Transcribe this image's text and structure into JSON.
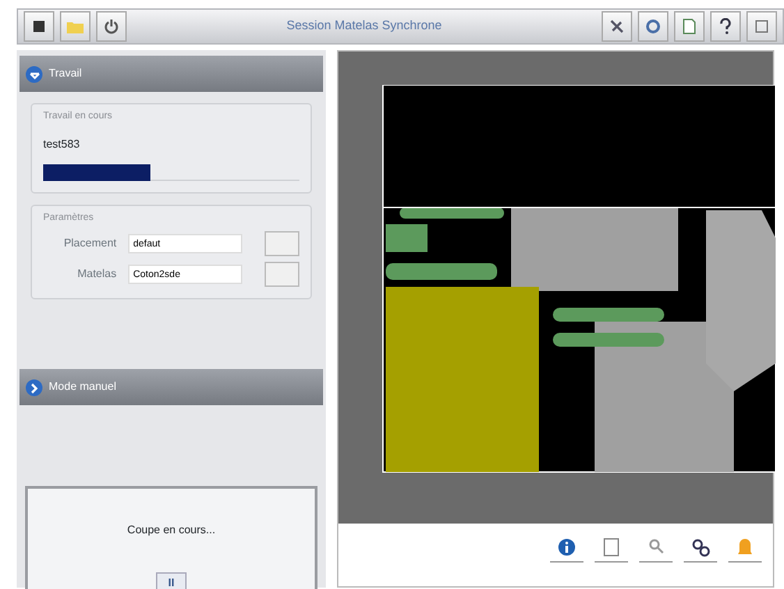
{
  "window": {
    "title": "Session Matelas Synchrone"
  },
  "panels": [
    {
      "title": "Travail",
      "expanded": true
    },
    {
      "title": "Mode manuel",
      "expanded": false
    }
  ],
  "job": {
    "legend": "Travail en cours",
    "name": "test583",
    "level": 0.42
  },
  "parameters": {
    "legend": "Paramètres",
    "fields": [
      {
        "label": "Placement",
        "value": "defaut"
      },
      {
        "label": "Matelas",
        "value": "Coton2sde"
      }
    ]
  },
  "status": {
    "message": "Coupe en cours...",
    "button": "II"
  }
}
